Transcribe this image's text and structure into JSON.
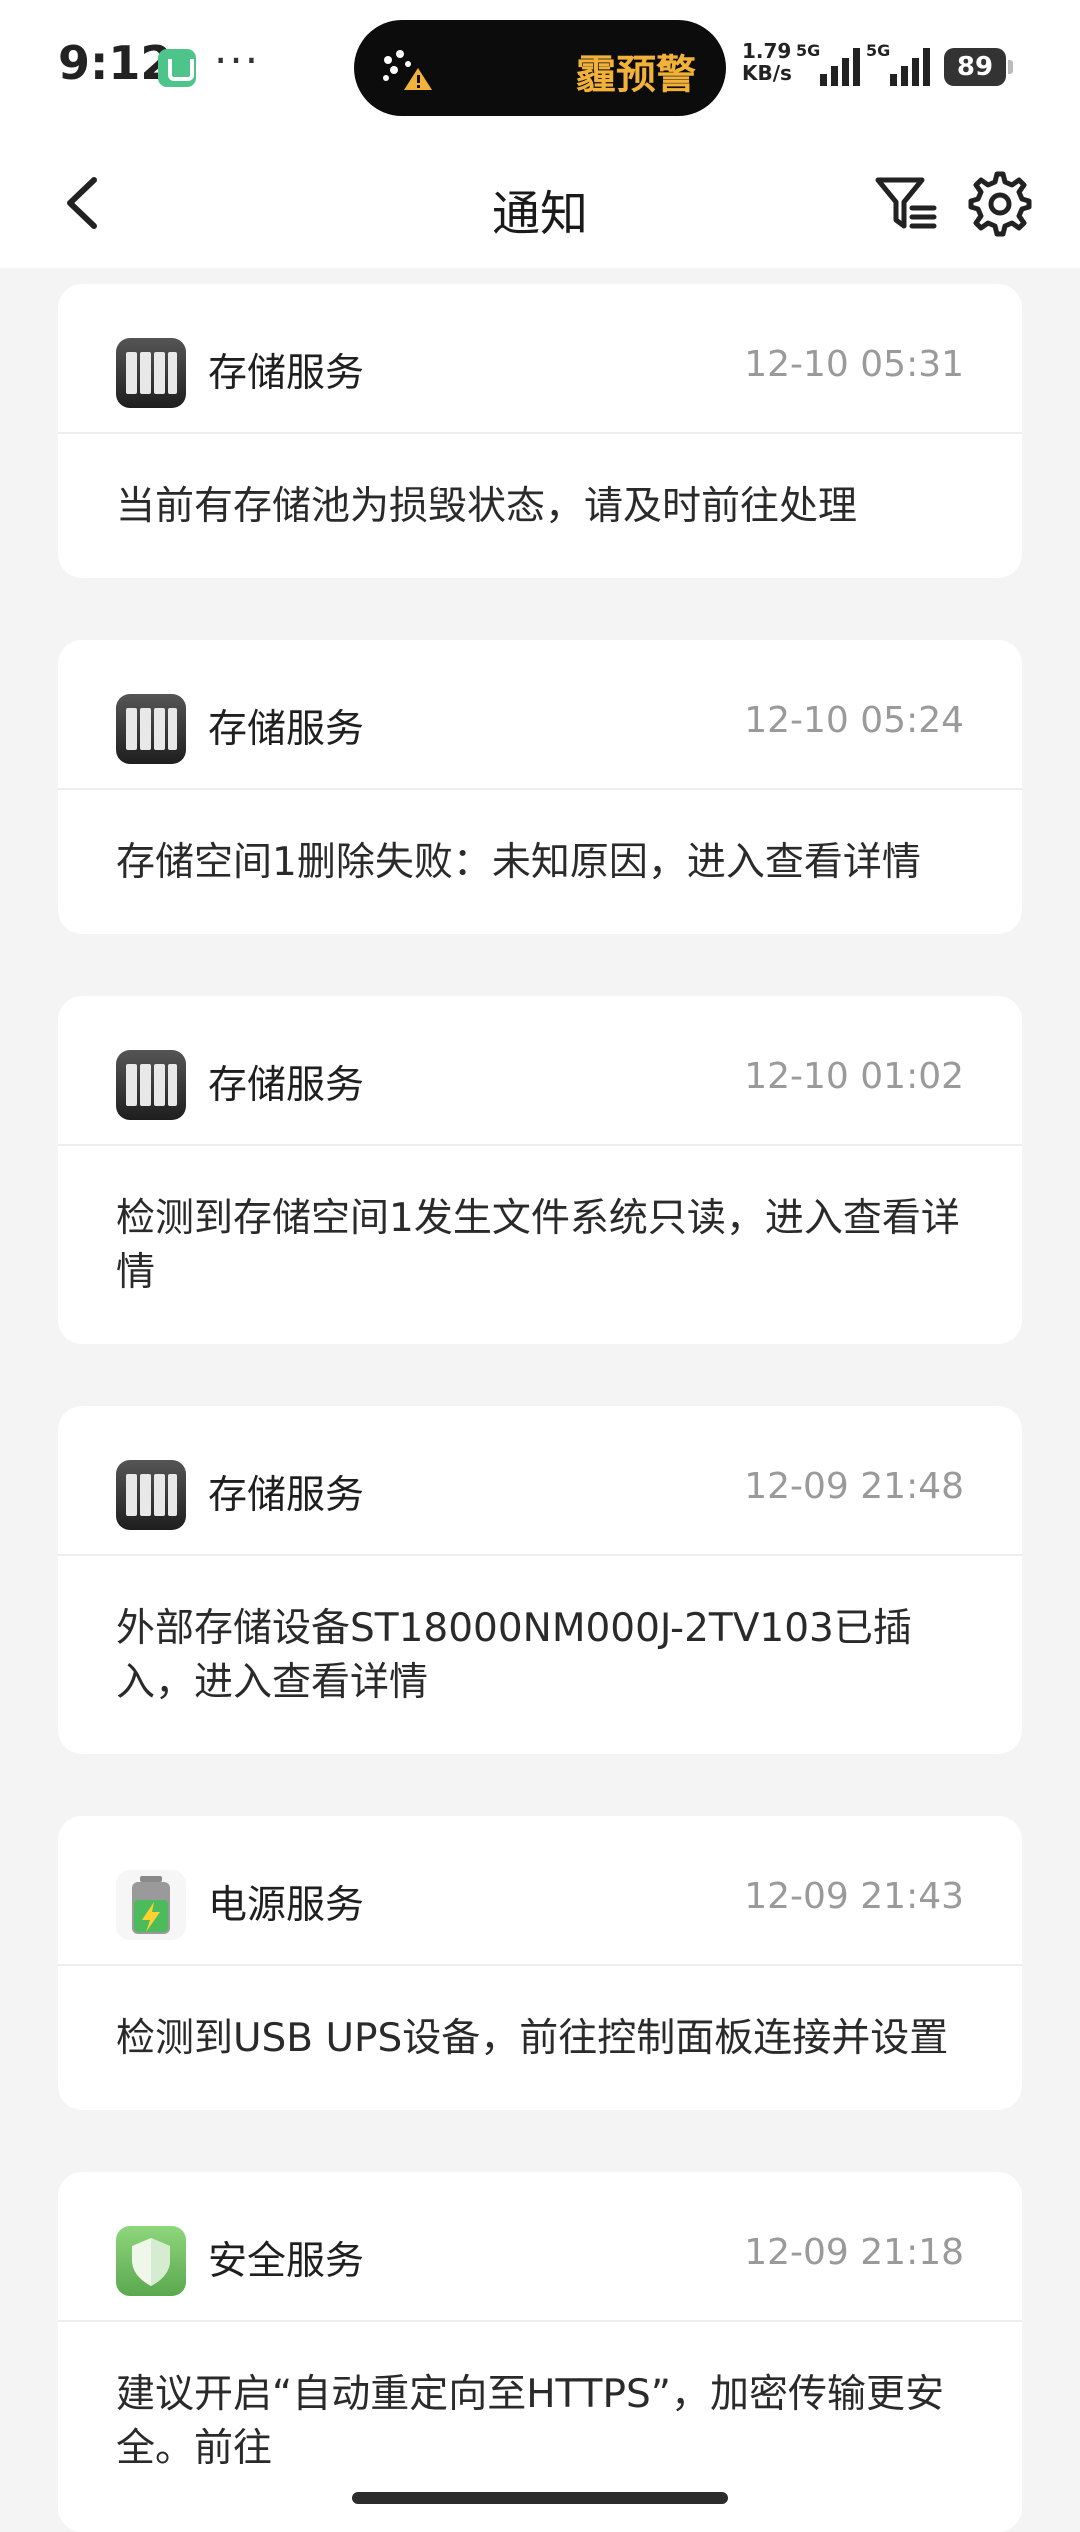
{
  "status_bar": {
    "time": "9:12",
    "dots": "···",
    "alert_text": "霾预警",
    "net_speed_value": "1.79",
    "net_speed_unit": "KB/s",
    "signal1_label": "5G",
    "signal2_label": "5G",
    "battery": "89"
  },
  "header": {
    "title": "通知"
  },
  "notifications": [
    {
      "service": "存储服务",
      "time": "12-10 05:31",
      "message": "当前有存储池为损毁状态，请及时前往处理",
      "icon": "storage-icon"
    },
    {
      "service": "存储服务",
      "time": "12-10 05:24",
      "message": "存储空间1删除失败：未知原因，进入查看详情",
      "icon": "storage-icon"
    },
    {
      "service": "存储服务",
      "time": "12-10 01:02",
      "message": "检测到存储空间1发生文件系统只读，进入查看详情",
      "icon": "storage-icon"
    },
    {
      "service": "存储服务",
      "time": "12-09 21:48",
      "message": "外部存储设备ST18000NM000J-2TV103已插入，进入查看详情",
      "icon": "storage-icon"
    },
    {
      "service": "电源服务",
      "time": "12-09 21:43",
      "message": "检测到USB UPS设备，前往控制面板连接并设置",
      "icon": "battery-icon"
    },
    {
      "service": "安全服务",
      "time": "12-09 21:18",
      "message": "建议开启“自动重定向至HTTPS”，加密传输更安全。前往",
      "icon": "shield-icon"
    }
  ],
  "colors": {
    "background": "#f4f4f4",
    "card": "#ffffff",
    "time_text": "#9a9a9a",
    "alert_text": "#f2b23a"
  }
}
